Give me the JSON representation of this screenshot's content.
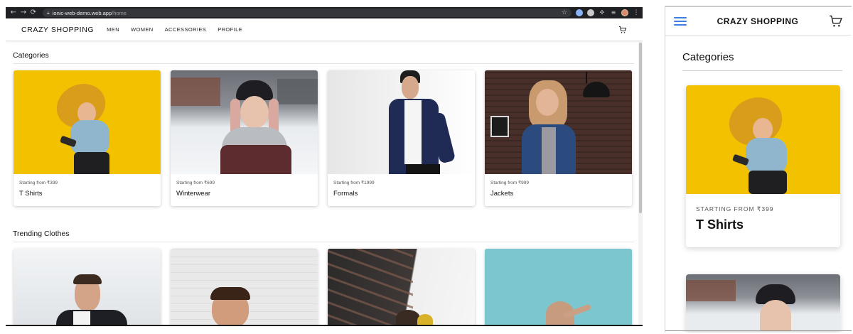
{
  "browser": {
    "url_host": "ionic-web-demo.web.app",
    "url_path": "/home"
  },
  "desktop": {
    "brand": "CRAZY SHOPPING",
    "nav": [
      "MEN",
      "WOMEN",
      "ACCESSORIES",
      "PROFILE"
    ],
    "sections": {
      "categories": "Categories",
      "trending": "Trending Clothes"
    },
    "categories": [
      {
        "from": "Starting from ₹399",
        "name": "T Shirts"
      },
      {
        "from": "Starting from ₹699",
        "name": "Winterwear"
      },
      {
        "from": "Starting from ₹1999",
        "name": "Formals"
      },
      {
        "from": "Starting from ₹999",
        "name": "Jackets"
      }
    ]
  },
  "mobile": {
    "brand": "CRAZY SHOPPING",
    "section": "Categories",
    "card": {
      "from": "STARTING FROM ₹399",
      "name": "T Shirts"
    }
  },
  "colors": {
    "chrome_dark": "#202124",
    "hamburger_accent": "#3d7fe0",
    "tshirt_bg": "#f2c200",
    "trend_blue": "#7cc7cf"
  },
  "icons": [
    "back-arrow-icon",
    "forward-arrow-icon",
    "reload-icon",
    "lock-icon",
    "star-icon",
    "puzzle-icon",
    "more-vertical-icon",
    "cart-icon",
    "hamburger-menu-icon"
  ]
}
